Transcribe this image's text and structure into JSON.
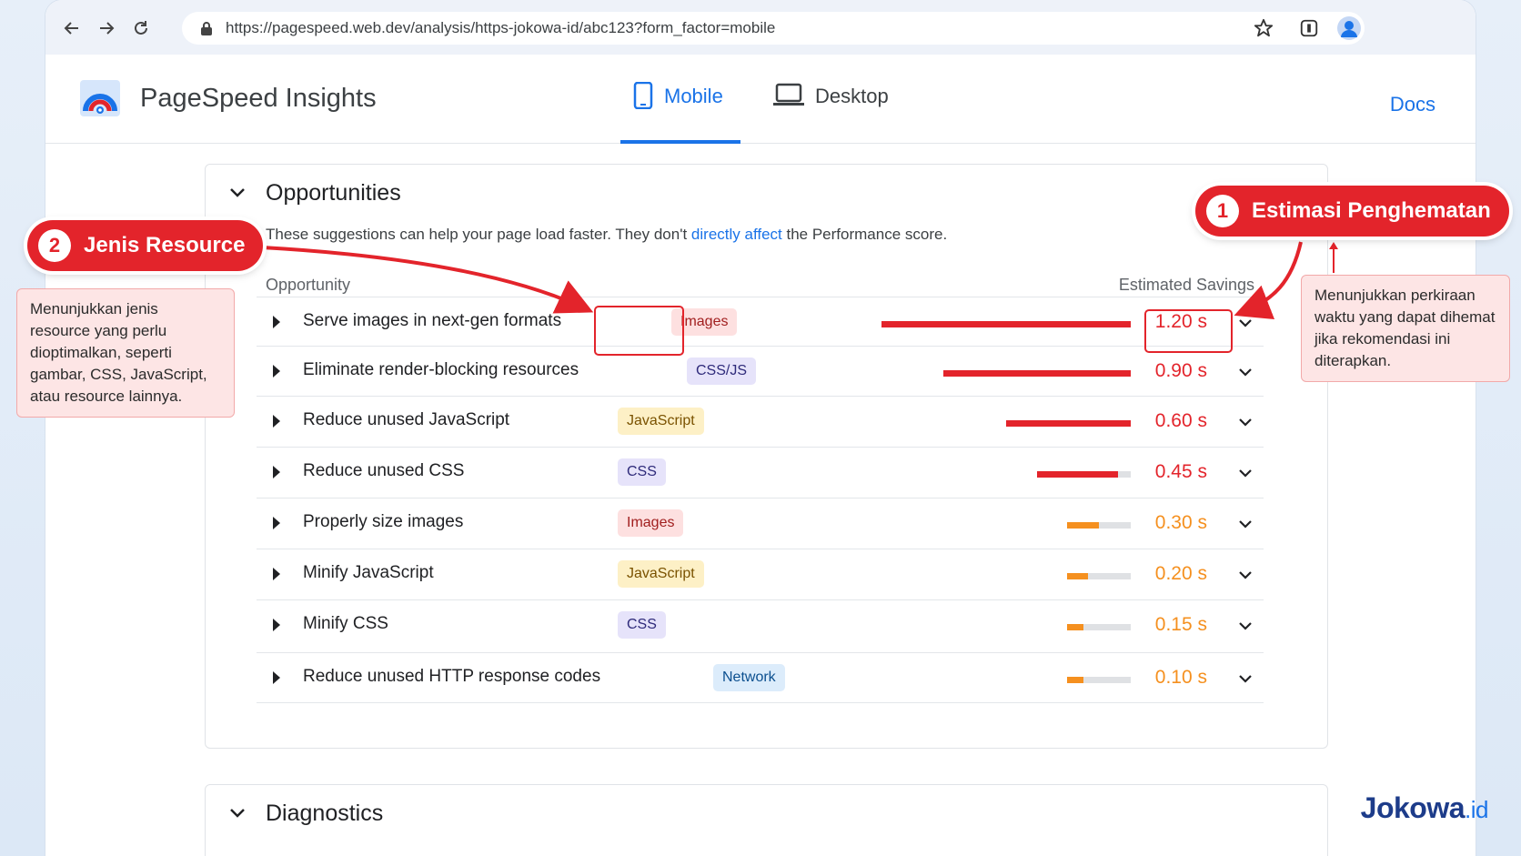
{
  "browser": {
    "url": "https://pagespeed.web.dev/analysis/https-jokowa-id/abc123?form_factor=mobile"
  },
  "header": {
    "brand": "PageSpeed Insights",
    "tabs": [
      {
        "label": "Mobile",
        "active": true
      },
      {
        "label": "Desktop",
        "active": false
      }
    ],
    "docs_label": "Docs"
  },
  "opportunities": {
    "title": "Opportunities",
    "description_before": "These suggestions can help your page load faster. They don't ",
    "description_link": "directly affect",
    "description_after": " the Performance score.",
    "col_opportunity": "Opportunity",
    "col_savings": "Estimated Savings",
    "rows": [
      {
        "title": "Serve images in next-gen formats",
        "badge": "Images",
        "saving": "1.20 s",
        "level": 1.0,
        "color": "#e3242b"
      },
      {
        "title": "Eliminate render-blocking resources",
        "badge": "CSS/JS",
        "saving": "0.90 s",
        "level": 0.75,
        "color": "#e3242b"
      },
      {
        "title": "Reduce unused JavaScript",
        "badge": "JavaScript",
        "saving": "0.60 s",
        "level": 0.5,
        "color": "#e3242b"
      },
      {
        "title": "Reduce unused CSS",
        "badge": "CSS",
        "saving": "0.45 s",
        "level": 0.375,
        "color": "#e3242b"
      },
      {
        "title": "Properly size images",
        "badge": "Images",
        "saving": "0.30 s",
        "level": 0.25,
        "color": "#f5901f"
      },
      {
        "title": "Minify JavaScript",
        "badge": "JavaScript",
        "saving": "0.20 s",
        "level": 0.167,
        "color": "#f5901f"
      },
      {
        "title": "Minify CSS",
        "badge": "CSS",
        "saving": "0.15 s",
        "level": 0.125,
        "color": "#f5901f"
      },
      {
        "title": "Reduce unused HTTP response codes",
        "badge": "Network",
        "saving": "0.10 s",
        "level": 0.083,
        "color": "#f5901f"
      }
    ]
  },
  "diagnostics": {
    "title": "Diagnostics"
  },
  "annotations": {
    "one": {
      "num": "1",
      "label": "Estimasi Penghematan",
      "note": "Menunjukkan perkiraan waktu yang dapat dihemat jika rekomendasi ini diterapkan."
    },
    "two": {
      "num": "2",
      "label": "Jenis Resource",
      "note": "Menunjukkan jenis resource yang perlu dioptimalkan, seperti gambar, CSS, JavaScript, atau resource lainnya."
    }
  },
  "watermark": {
    "main": "Jokowa",
    "suffix": ".id"
  },
  "colors": {
    "accent": "#1a73e8",
    "annotation": "#e3242b",
    "fail": "#e3242b",
    "average": "#f5901f"
  }
}
